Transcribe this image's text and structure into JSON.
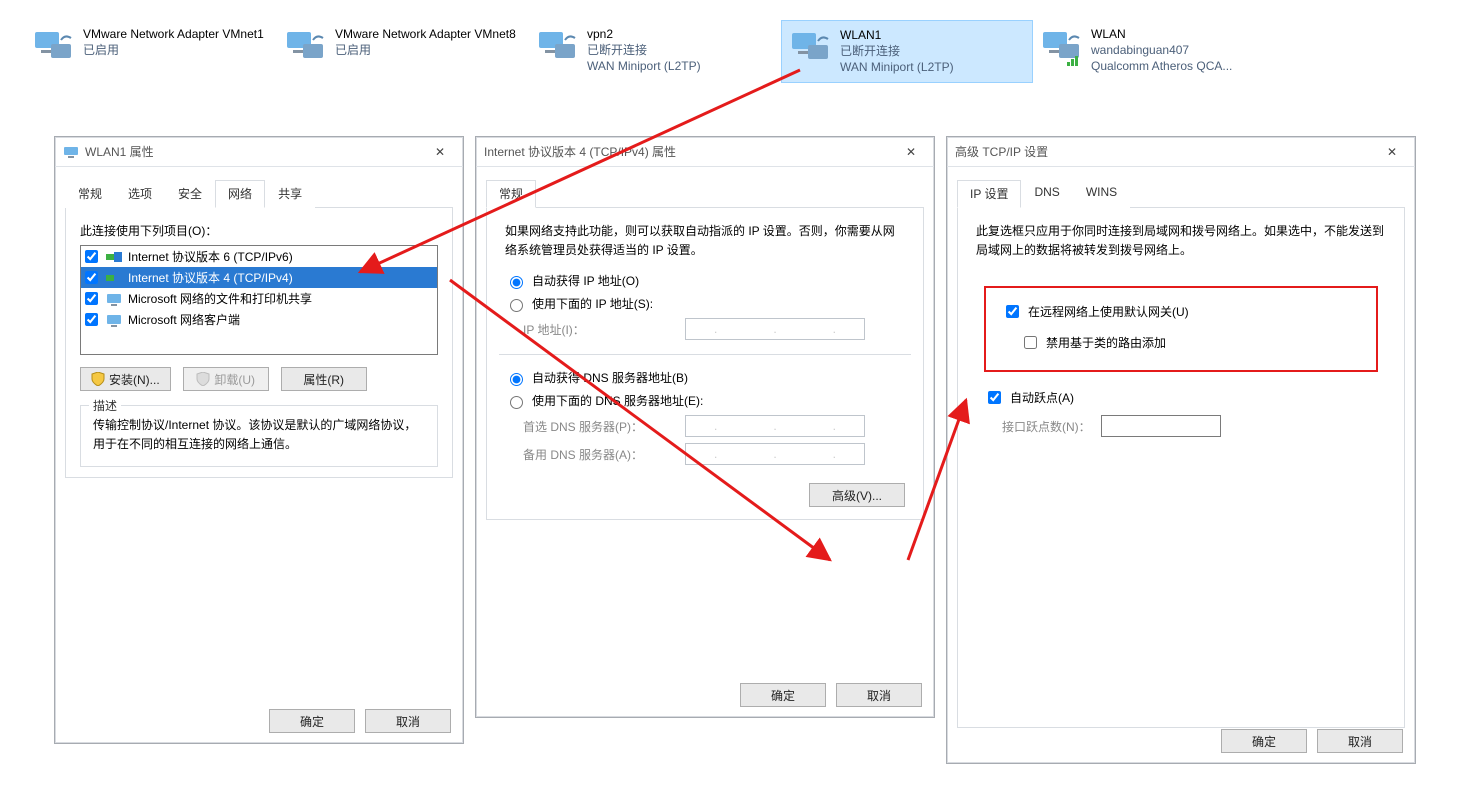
{
  "adapters": [
    {
      "name": "VMware Network Adapter VMnet1",
      "line2": "已启用",
      "line3": ""
    },
    {
      "name": "VMware Network Adapter VMnet8",
      "line2": "已启用",
      "line3": ""
    },
    {
      "name": "vpn2",
      "line2": "已断开连接",
      "line3": "WAN Miniport (L2TP)"
    },
    {
      "name": "WLAN1",
      "line2": "已断开连接",
      "line3": "WAN Miniport (L2TP)",
      "selected": true
    },
    {
      "name": "WLAN",
      "line2": "wandabinguan407",
      "line3": "Qualcomm Atheros QCA..."
    }
  ],
  "dlg1": {
    "title": "WLAN1 属性",
    "tabs": [
      "常规",
      "选项",
      "安全",
      "网络",
      "共享"
    ],
    "active_tab": 3,
    "list_label": "此连接使用下列项目(O)：",
    "items": [
      {
        "label": "Internet 协议版本 6 (TCP/IPv6)",
        "checked": true,
        "icon": "proto"
      },
      {
        "label": "Internet 协议版本 4 (TCP/IPv4)",
        "checked": true,
        "icon": "proto",
        "sel": true
      },
      {
        "label": "Microsoft 网络的文件和打印机共享",
        "checked": true,
        "icon": "svc"
      },
      {
        "label": "Microsoft 网络客户端",
        "checked": true,
        "icon": "svc"
      }
    ],
    "btn_install": "安装(N)...",
    "btn_uninstall": "卸载(U)",
    "btn_props": "属性(R)",
    "desc_title": "描述",
    "desc_text": "传输控制协议/Internet 协议。该协议是默认的广域网络协议，用于在不同的相互连接的网络上通信。",
    "ok": "确定",
    "cancel": "取消"
  },
  "dlg2": {
    "title": "Internet 协议版本 4 (TCP/IPv4) 属性",
    "tab": "常规",
    "intro": "如果网络支持此功能，则可以获取自动指派的 IP 设置。否则，你需要从网络系统管理员处获得适当的 IP 设置。",
    "r_ip_auto": "自动获得 IP 地址(O)",
    "r_ip_manual": "使用下面的 IP 地址(S):",
    "l_ip": "IP 地址(I)：",
    "r_dns_auto": "自动获得 DNS 服务器地址(B)",
    "r_dns_manual": "使用下面的 DNS 服务器地址(E):",
    "l_dns1": "首选 DNS 服务器(P)：",
    "l_dns2": "备用 DNS 服务器(A)：",
    "btn_advanced": "高级(V)...",
    "ok": "确定",
    "cancel": "取消"
  },
  "dlg3": {
    "title": "高级 TCP/IP 设置",
    "tabs": [
      "IP 设置",
      "DNS",
      "WINS"
    ],
    "active_tab": 0,
    "intro": "此复选框只应用于你同时连接到局域网和拨号网络上。如果选中，不能发送到局域网上的数据将被转发到拨号网络上。",
    "chk_gateway": "在远程网络上使用默认网关(U)",
    "chk_classroute": "禁用基于类的路由添加",
    "chk_autohop": "自动跃点(A)",
    "lbl_hopcount": "接口跃点数(N)：",
    "ok": "确定",
    "cancel": "取消"
  }
}
